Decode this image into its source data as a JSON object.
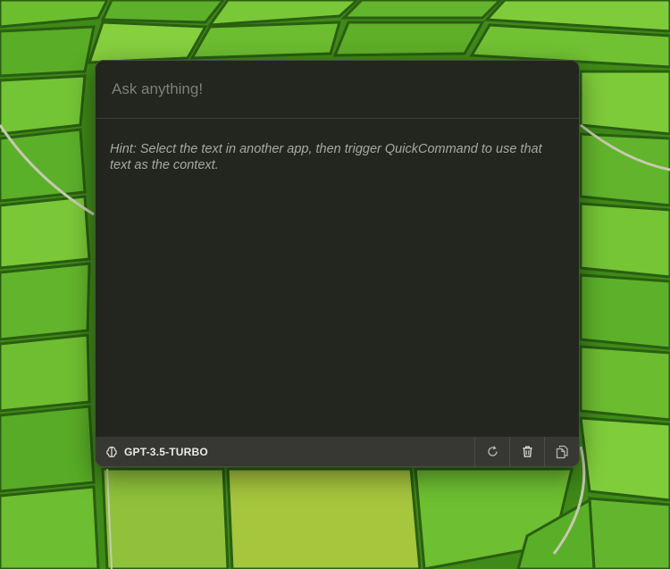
{
  "query": {
    "placeholder": "Ask anything!",
    "value": ""
  },
  "hint": {
    "text": "Hint: Select the text in another app, then trigger QuickCommand to use that text as the context."
  },
  "footer": {
    "model_label": "GPT-3.5-TURBO",
    "model_icon": "brain-icon",
    "actions": [
      {
        "name": "regenerate",
        "icon": "refresh-icon"
      },
      {
        "name": "clear",
        "icon": "trash-icon"
      },
      {
        "name": "copy",
        "icon": "copy-icon"
      }
    ]
  },
  "colors": {
    "panel_bg": "#23261f",
    "footer_bg": "#373833",
    "caret": "#4aa3ff"
  }
}
